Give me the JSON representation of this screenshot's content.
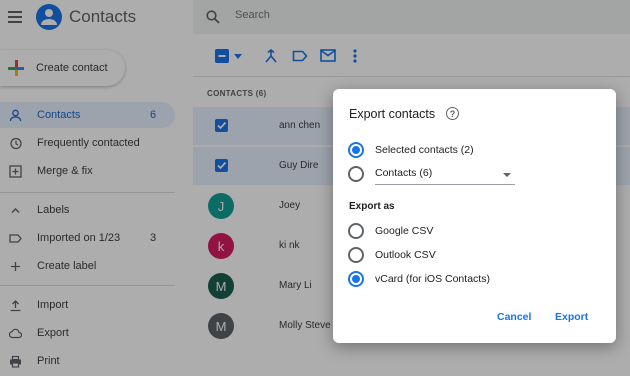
{
  "app": {
    "title": "Contacts"
  },
  "sidebar": {
    "create_label": "Create contact",
    "items": [
      {
        "label": "Contacts",
        "count": "6"
      },
      {
        "label": "Frequently contacted",
        "count": ""
      },
      {
        "label": "Merge & fix",
        "count": ""
      }
    ],
    "labels_heading": "Labels",
    "label_items": [
      {
        "label": "Imported on 1/23",
        "count": "3"
      },
      {
        "label": "Create label",
        "count": ""
      }
    ],
    "bottom_items": [
      {
        "label": "Import"
      },
      {
        "label": "Export"
      },
      {
        "label": "Print"
      }
    ]
  },
  "search": {
    "placeholder": "Search"
  },
  "list": {
    "section_label": "CONTACTS (6)",
    "rows": [
      {
        "name": "ann chen",
        "selected": true,
        "initial": ""
      },
      {
        "name": "Guy Dire",
        "selected": true,
        "initial": ""
      },
      {
        "name": "Joey",
        "selected": false,
        "initial": "J",
        "color": "#129e95"
      },
      {
        "name": "ki nk",
        "selected": false,
        "initial": "k",
        "color": "#d81b60"
      },
      {
        "name": "Mary Li",
        "selected": false,
        "initial": "M",
        "color": "#1b5e50"
      },
      {
        "name": "Molly Steve",
        "selected": false,
        "initial": "M",
        "color": "#5f6368"
      }
    ]
  },
  "dialog": {
    "title": "Export contacts",
    "options": [
      {
        "label": "Selected contacts (2)",
        "checked": true
      },
      {
        "label": "Contacts (6)",
        "checked": false
      }
    ],
    "export_as_heading": "Export as",
    "formats": [
      {
        "label": "Google CSV",
        "checked": false
      },
      {
        "label": "Outlook CSV",
        "checked": false
      },
      {
        "label": "vCard (for iOS Contacts)",
        "checked": true
      }
    ],
    "cancel_label": "Cancel",
    "export_label": "Export"
  },
  "colors": {
    "accent": "#1a73e8",
    "brand": "#1a73e8"
  }
}
